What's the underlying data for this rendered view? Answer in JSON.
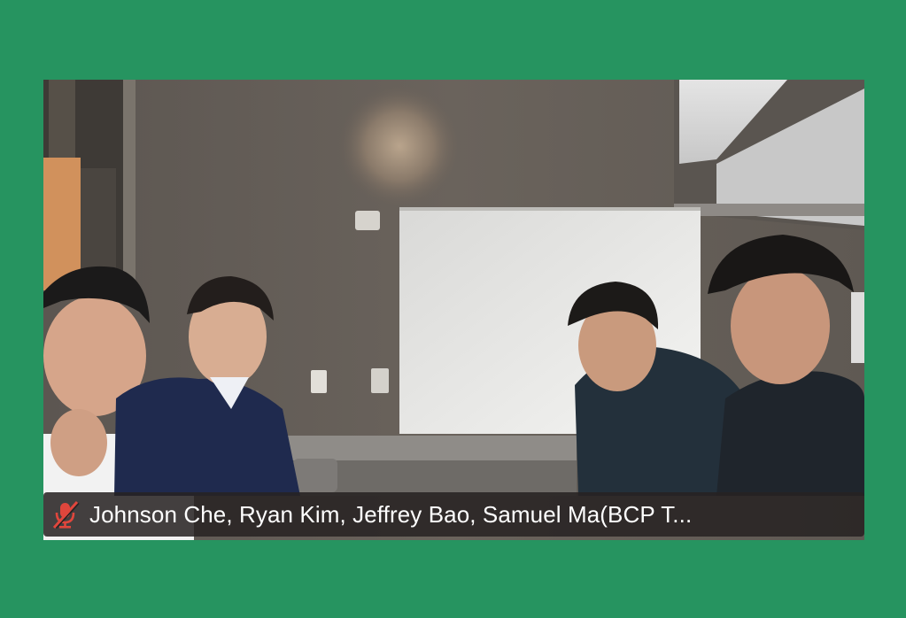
{
  "meeting": {
    "participants_label": "Johnson Che, Ryan Kim, Jeffrey Bao, Samuel Ma(BCP T...",
    "audio_status_icon": "microphone-muted-icon",
    "accent_colors": {
      "page_background": "#269460",
      "muted_icon": "#e0463c",
      "name_bar": "#262222"
    }
  }
}
